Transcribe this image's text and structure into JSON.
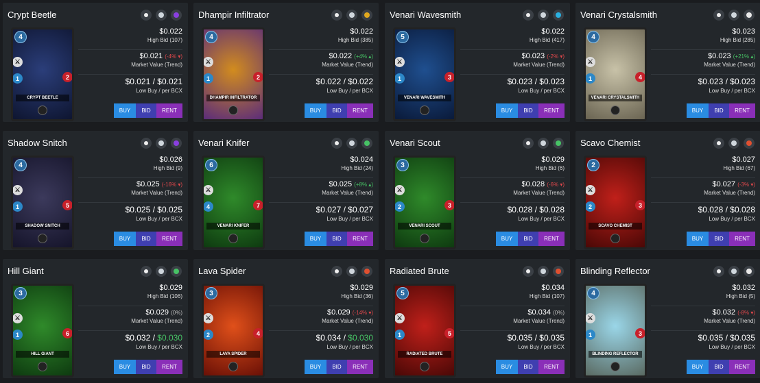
{
  "cards": [
    {
      "name": "Crypt Beetle",
      "art_label": "CRYPT BEETLE",
      "mana": "4",
      "speed": "1",
      "health": "2",
      "colors": [
        "#2b3e7a",
        "#0e1530"
      ],
      "element_color": "#8a3fe0",
      "price": "$0.022",
      "high_bid": "High Bid (107)",
      "market": "$0.021",
      "trend": "(-4% ▾)",
      "trend_dir": "down",
      "market_label": "Market Value (Trend)",
      "low_buy": "$0.021",
      "low_bcx": "$0.021",
      "low_label": "Low Buy / per BCX",
      "buy": "BUY",
      "bid": "BID",
      "rent": "RENT"
    },
    {
      "name": "Dhampir Infiltrator",
      "art_label": "DHAMPIR INFILTRATOR",
      "mana": "4",
      "speed": "1",
      "health": "2",
      "colors": [
        "#d28c1e",
        "#5b2c7a"
      ],
      "element_color": "#e0a81e",
      "price": "$0.022",
      "high_bid": "High Bid (385)",
      "market": "$0.022",
      "trend": "(+4% ▴)",
      "trend_dir": "up",
      "market_label": "Market Value (Trend)",
      "low_buy": "$0.022",
      "low_bcx": "$0.022",
      "low_label": "Low Buy / per BCX",
      "buy": "BUY",
      "bid": "BID",
      "rent": "RENT"
    },
    {
      "name": "Venari Wavesmith",
      "art_label": "VENARI WAVESMITH",
      "mana": "5",
      "speed": "1",
      "health": "3",
      "colors": [
        "#1f4f8f",
        "#0a1a3a"
      ],
      "element_color": "#2ab0e0",
      "price": "$0.022",
      "high_bid": "High Bid (417)",
      "market": "$0.023",
      "trend": "(-2% ▾)",
      "trend_dir": "down",
      "market_label": "Market Value (Trend)",
      "low_buy": "$0.023",
      "low_bcx": "$0.023",
      "low_label": "Low Buy / per BCX",
      "buy": "BUY",
      "bid": "BID",
      "rent": "RENT"
    },
    {
      "name": "Venari Crystalsmith",
      "art_label": "VENARI CRYSTALSMITH",
      "mana": "4",
      "speed": "1",
      "health": "4",
      "colors": [
        "#c8c2a8",
        "#6a6452"
      ],
      "element_color": "#e8e8e8",
      "price": "$0.023",
      "high_bid": "High Bid (285)",
      "market": "$0.023",
      "trend": "(+21% ▴)",
      "trend_dir": "up",
      "market_label": "Market Value (Trend)",
      "low_buy": "$0.023",
      "low_bcx": "$0.023",
      "low_label": "Low Buy / per BCX",
      "buy": "BUY",
      "bid": "BID",
      "rent": "RENT"
    },
    {
      "name": "Shadow Snitch",
      "art_label": "SHADOW SNITCH",
      "mana": "4",
      "speed": "1",
      "health": "5",
      "colors": [
        "#3c3a5c",
        "#15142a"
      ],
      "element_color": "#8a3fe0",
      "price": "$0.026",
      "high_bid": "High Bid (9)",
      "market": "$0.025",
      "trend": "(-16% ▾)",
      "trend_dir": "down",
      "market_label": "Market Value (Trend)",
      "low_buy": "$0.025",
      "low_bcx": "$0.025",
      "low_label": "Low Buy / per BCX",
      "buy": "BUY",
      "bid": "BID",
      "rent": "RENT"
    },
    {
      "name": "Venari Knifer",
      "art_label": "VENARI KNIFER",
      "mana": "6",
      "speed": "4",
      "health": "7",
      "colors": [
        "#2f8a2a",
        "#0e3a10"
      ],
      "element_color": "#47c265",
      "price": "$0.024",
      "high_bid": "High Bid (24)",
      "market": "$0.025",
      "trend": "(+8% ▴)",
      "trend_dir": "up",
      "market_label": "Market Value (Trend)",
      "low_buy": "$0.027",
      "low_bcx": "$0.027",
      "low_label": "Low Buy / per BCX",
      "buy": "BUY",
      "bid": "BID",
      "rent": "RENT"
    },
    {
      "name": "Venari Scout",
      "art_label": "VENARI SCOUT",
      "mana": "3",
      "speed": "2",
      "health": "3",
      "colors": [
        "#2f8a2a",
        "#0e3a10"
      ],
      "element_color": "#47c265",
      "price": "$0.029",
      "high_bid": "High Bid (6)",
      "market": "$0.028",
      "trend": "(-6% ▾)",
      "trend_dir": "down",
      "market_label": "Market Value (Trend)",
      "low_buy": "$0.028",
      "low_bcx": "$0.028",
      "low_label": "Low Buy / per BCX",
      "buy": "BUY",
      "bid": "BID",
      "rent": "RENT"
    },
    {
      "name": "Scavo Chemist",
      "art_label": "SCAVO CHEMIST",
      "mana": "2",
      "speed": "2",
      "health": "3",
      "colors": [
        "#c0201a",
        "#4a0806"
      ],
      "element_color": "#e05030",
      "price": "$0.027",
      "high_bid": "High Bid (67)",
      "market": "$0.027",
      "trend": "(-3% ▾)",
      "trend_dir": "down",
      "market_label": "Market Value (Trend)",
      "low_buy": "$0.028",
      "low_bcx": "$0.028",
      "low_label": "Low Buy / per BCX",
      "buy": "BUY",
      "bid": "BID",
      "rent": "RENT"
    },
    {
      "name": "Hill Giant",
      "art_label": "HILL GIANT",
      "mana": "3",
      "speed": "1",
      "health": "6",
      "colors": [
        "#2f8a2a",
        "#0e3a10"
      ],
      "element_color": "#47c265",
      "price": "$0.029",
      "high_bid": "High Bid (106)",
      "market": "$0.029",
      "trend": "(0%)",
      "trend_dir": "flat",
      "market_label": "Market Value (Trend)",
      "low_buy": "$0.032",
      "low_bcx": "$0.030",
      "low_bcx_green": true,
      "low_label": "Low Buy / per BCX",
      "buy": "BUY",
      "bid": "BID",
      "rent": "RENT"
    },
    {
      "name": "Lava Spider",
      "art_label": "LAVA SPIDER",
      "mana": "3",
      "speed": "2",
      "health": "4",
      "colors": [
        "#e0501a",
        "#6a1006"
      ],
      "element_color": "#e05030",
      "price": "$0.029",
      "high_bid": "High Bid (36)",
      "market": "$0.029",
      "trend": "(-14% ▾)",
      "trend_dir": "down",
      "market_label": "Market Value (Trend)",
      "low_buy": "$0.034",
      "low_bcx": "$0.030",
      "low_bcx_green": true,
      "low_label": "Low Buy / per BCX",
      "buy": "BUY",
      "bid": "BID",
      "rent": "RENT"
    },
    {
      "name": "Radiated Brute",
      "art_label": "RADIATED BRUTE",
      "mana": "5",
      "speed": "1",
      "health": "5",
      "colors": [
        "#c0201a",
        "#4a0806"
      ],
      "element_color": "#e05030",
      "price": "$0.034",
      "high_bid": "High Bid (107)",
      "market": "$0.034",
      "trend": "(0%)",
      "trend_dir": "flat",
      "market_label": "Market Value (Trend)",
      "low_buy": "$0.035",
      "low_bcx": "$0.035",
      "low_label": "Low Buy / per BCX",
      "buy": "BUY",
      "bid": "BID",
      "rent": "RENT"
    },
    {
      "name": "Blinding Reflector",
      "art_label": "BLINDING REFLECTOR",
      "mana": "4",
      "speed": "1",
      "health": "3",
      "colors": [
        "#9ad6e8",
        "#5a6a62"
      ],
      "element_color": "#e8e8e8",
      "price": "$0.032",
      "high_bid": "High Bid (5)",
      "market": "$0.032",
      "trend": "(-8% ▾)",
      "trend_dir": "down",
      "market_label": "Market Value (Trend)",
      "low_buy": "$0.035",
      "low_bcx": "$0.035",
      "low_label": "Low Buy / per BCX",
      "buy": "BUY",
      "bid": "BID",
      "rent": "RENT"
    }
  ]
}
